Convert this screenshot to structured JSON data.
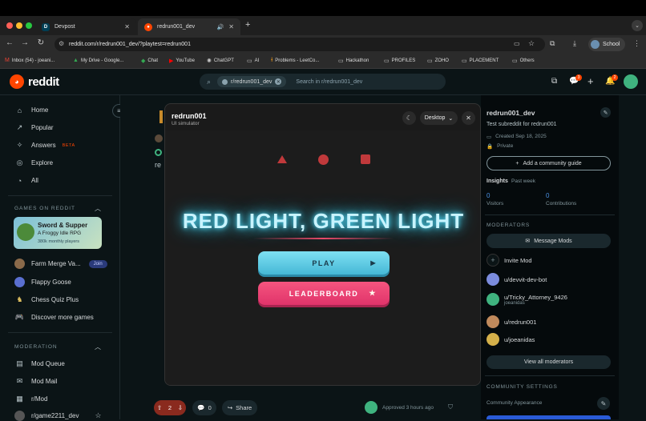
{
  "browser": {
    "tabs": [
      {
        "title": "Devpost",
        "favicon": "D"
      },
      {
        "title": "redrun001_dev"
      }
    ],
    "url": "reddit.com/r/redrun001_dev/?playtest=redrun001",
    "profile": "School",
    "bookmarks": [
      "Inbox (54) - joeani...",
      "My Drive - Google...",
      "Chat",
      "YouTube",
      "ChatGPT",
      "AI",
      "Problems - LeetCo...",
      "Hackathon",
      "PROFILES",
      "ZOHO",
      "PLACEMENT",
      "Others"
    ]
  },
  "reddit": {
    "logo": "reddit",
    "search": {
      "chip": "r/redrun001_dev",
      "placeholder": "Search in r/redrun001_dev"
    },
    "badges": {
      "chat": "3",
      "notifications": "2"
    }
  },
  "sidebar": {
    "nav": [
      {
        "label": "Home",
        "icon": "home-icon"
      },
      {
        "label": "Popular",
        "icon": "popular-icon"
      },
      {
        "label": "Answers",
        "icon": "answers-icon",
        "badge": "BETA"
      },
      {
        "label": "Explore",
        "icon": "explore-icon"
      },
      {
        "label": "All",
        "icon": "all-icon"
      }
    ],
    "games_heading": "GAMES ON REDDIT",
    "featured_game": {
      "title": "Sword & Supper",
      "subtitle": "A Froggy Idle RPG",
      "players": "380k monthly players"
    },
    "games": [
      {
        "label": "Farm Merge Va...",
        "action": "Join"
      },
      {
        "label": "Flappy Goose"
      },
      {
        "label": "Chess Quiz Plus"
      },
      {
        "label": "Discover more games"
      }
    ],
    "moderation_heading": "MODERATION",
    "moderation": [
      {
        "label": "Mod Queue"
      },
      {
        "label": "Mod Mail"
      },
      {
        "label": "r/Mod"
      },
      {
        "label": "r/game2211_dev"
      }
    ]
  },
  "post": {
    "votes": "2",
    "comments": "0",
    "share": "Share",
    "approved": "Approved 3 hours ago"
  },
  "modal": {
    "title": "redrun001",
    "subtitle": "UI simulator",
    "device": "Desktop",
    "game": {
      "title": "RED LIGHT, GREEN LIGHT",
      "play": "PLAY",
      "leaderboard": "LEADERBOARD"
    }
  },
  "right": {
    "name": "redrun001_dev",
    "description": "Test subreddit for redrun001",
    "created": "Created Sep 18, 2025",
    "privacy": "Private",
    "guide_button": "Add a community guide",
    "insights_label": "Insights",
    "insights_period": "Past week",
    "stats": [
      {
        "value": "0",
        "label": "Visitors"
      },
      {
        "value": "0",
        "label": "Contributions"
      }
    ],
    "moderators_heading": "MODERATORS",
    "message_mods": "Message Mods",
    "invite": "Invite Mod",
    "mods": [
      {
        "name": "u/devvit-dev-bot",
        "color": "#7b8cde"
      },
      {
        "name": "u/Tricky_Attorney_9426",
        "sub": "joeanidas",
        "color": "#3fb37f"
      },
      {
        "name": "u/redrun001",
        "color": "#c08a5c"
      },
      {
        "name": "u/joeanidas",
        "color": "#d4b04a"
      }
    ],
    "view_all": "View all moderators",
    "settings_heading": "COMMUNITY SETTINGS",
    "appearance": "Community Appearance"
  },
  "colors": {
    "accent": "#ff4500",
    "play": "#5bc8e0",
    "leaderboard": "#f0457a",
    "glow": "#4fd6f2"
  }
}
